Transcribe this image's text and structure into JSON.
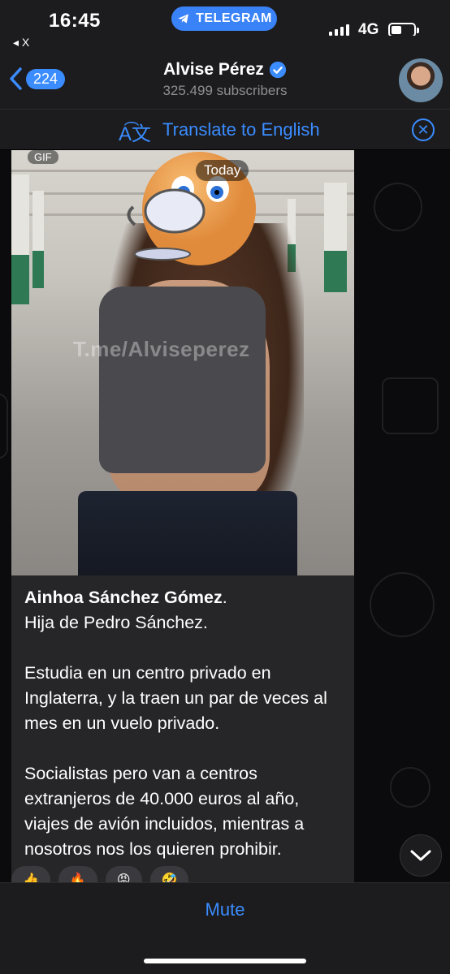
{
  "status_bar": {
    "time": "16:45",
    "app_pill": "TELEGRAM",
    "back_app": "◂ X",
    "network": "4G"
  },
  "header": {
    "back_badge": "224",
    "channel_name": "Alvise Pérez",
    "subscribers": "325.499 subscribers"
  },
  "translate": {
    "label": "Translate to English",
    "icon": "translate-icon"
  },
  "message": {
    "gif_label": "GIF",
    "date": "Today",
    "watermark": "T.me/Alviseperez",
    "name": "Ainhoa Sánchez Gómez",
    "name_suffix": ".",
    "line2": "Hija de Pedro Sánchez.",
    "para2": "Estudia en un centro privado en Inglaterra, y la traen un par de veces al mes en un vuelo privado.",
    "para3": "Socialistas pero van a centros extranjeros de 40.000 euros al año, viajes de avión incluidos, mientras a nosotros nos los quieren prohibir."
  },
  "bottom": {
    "mute_label": "Mute"
  },
  "colors": {
    "accent": "#3a8cff",
    "background": "#000000",
    "bar": "#1c1c1e",
    "bubble": "#262628"
  }
}
